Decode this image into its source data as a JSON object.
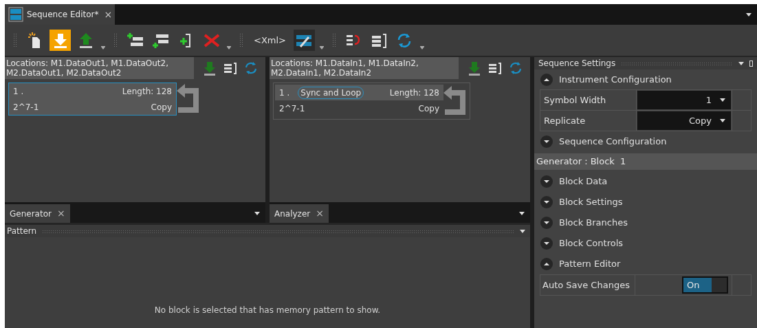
{
  "document_tab": {
    "title": "Sequence Editor*",
    "close": "×"
  },
  "toolbar": [
    {
      "kind": "new",
      "active": false
    },
    {
      "kind": "download",
      "active": true
    },
    {
      "kind": "upload",
      "active": false
    },
    {
      "kind": "separator"
    },
    {
      "kind": "addabove",
      "active": false
    },
    {
      "kind": "addbelow",
      "active": false
    },
    {
      "kind": "insert",
      "active": false
    },
    {
      "kind": "delete",
      "active": false
    },
    {
      "kind": "separator"
    },
    {
      "kind": "text",
      "label": "<Xml>",
      "active": false
    },
    {
      "kind": "binary",
      "active": true
    },
    {
      "kind": "separator"
    },
    {
      "kind": "branch",
      "active": false
    },
    {
      "kind": "listreturn",
      "active": false
    },
    {
      "kind": "refresh",
      "active": false
    }
  ],
  "panels": [
    {
      "locations": "Locations: M1.DataOut1, M1.DataOut2, M2.DataOut1, M2.DataOut2",
      "block": {
        "index": "1 .",
        "length": "Length: 128",
        "pattern": "2^7-1",
        "replicate": "Copy",
        "selected": true
      }
    },
    {
      "locations": "Locations: M1.DataIn1, M1.DataIn2, M2.DataIn1, M2.DataIn2",
      "block": {
        "index": "1 .",
        "badge": "Sync and Loop",
        "length": "Length: 128",
        "pattern": "2^7-1",
        "replicate": "Copy",
        "selected": false
      }
    }
  ],
  "panel_tabs": [
    {
      "label": "Generator",
      "close": "×"
    },
    {
      "label": "Analyzer",
      "close": "×"
    }
  ],
  "pattern": {
    "title": "Pattern",
    "message": "No block is selected that has memory pattern to show."
  },
  "settings": {
    "title": "Sequence Settings",
    "items": [
      {
        "kind": "section",
        "label": "Instrument Configuration",
        "expanded": true
      },
      {
        "kind": "property",
        "label": "Symbol Width",
        "value": "1"
      },
      {
        "kind": "property",
        "label": "Replicate",
        "value": "Copy"
      },
      {
        "kind": "section",
        "label": "Sequence Configuration",
        "expanded": false
      },
      {
        "kind": "header",
        "label": "Generator : Block  1"
      },
      {
        "kind": "section",
        "label": "Block Data",
        "expanded": false
      },
      {
        "kind": "section",
        "label": "Block Settings",
        "expanded": false
      },
      {
        "kind": "section",
        "label": "Block Branches",
        "expanded": false
      },
      {
        "kind": "section",
        "label": "Block Controls",
        "expanded": false
      },
      {
        "kind": "section",
        "label": "Pattern Editor",
        "expanded": true
      },
      {
        "kind": "toggle",
        "label": "Auto Save Changes",
        "on": true,
        "text": "On"
      }
    ]
  }
}
